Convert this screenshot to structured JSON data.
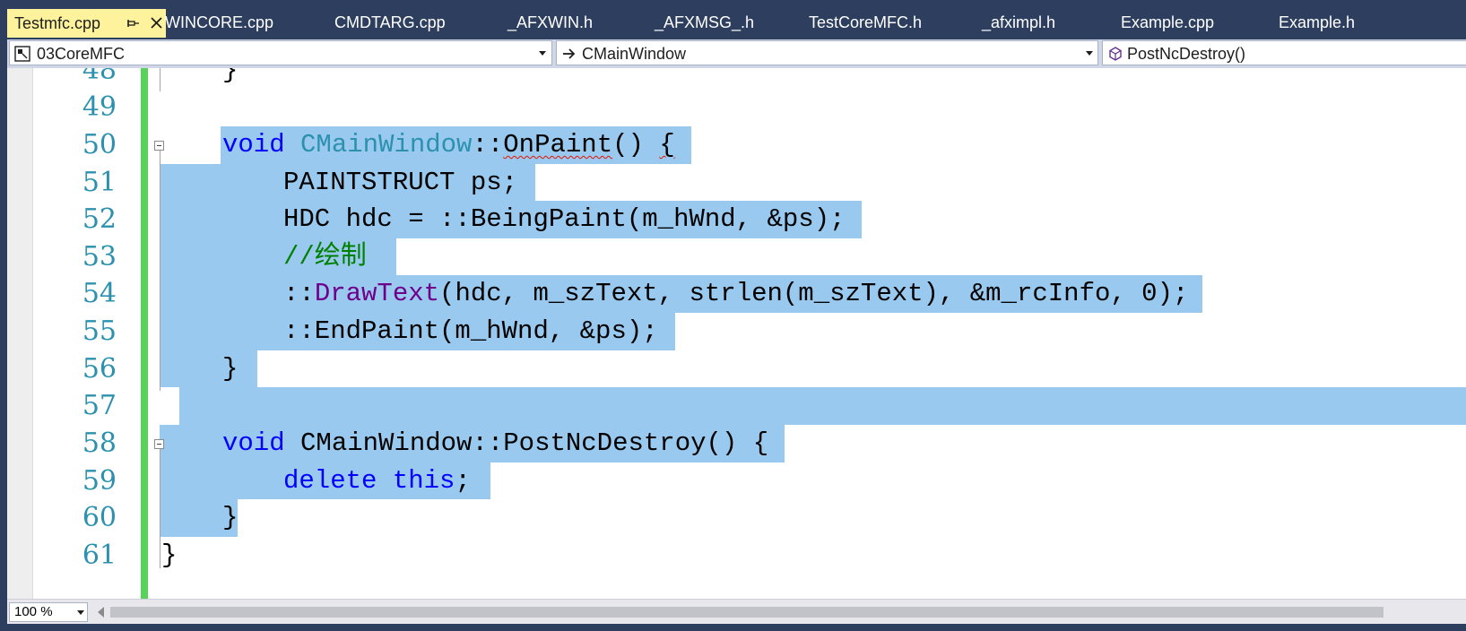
{
  "tabs": [
    {
      "label": "Testmfc.cpp",
      "active": true
    },
    {
      "label": "WINCORE.cpp"
    },
    {
      "label": "CMDTARG.cpp"
    },
    {
      "label": "_AFXWIN.h"
    },
    {
      "label": "_AFXMSG_.h"
    },
    {
      "label": "TestCoreMFC.h"
    },
    {
      "label": "_afximpl.h"
    },
    {
      "label": "Example.cpp"
    },
    {
      "label": "Example.h"
    }
  ],
  "navbar": {
    "project": "03CoreMFC",
    "scope": "CMainWindow",
    "member": "PostNcDestroy()"
  },
  "editor": {
    "line_numbers": [
      "48",
      "49",
      "50",
      "51",
      "52",
      "53",
      "54",
      "55",
      "56",
      "57",
      "58",
      "59",
      "60",
      "61"
    ],
    "lines": {
      "l48": "}",
      "l50": {
        "kw": "void",
        "cls": "CMainWindow",
        "sep": "::",
        "fn": "OnPaint",
        "paren": "()",
        "brace": "{"
      },
      "l51": "PAINTSTRUCT ps;",
      "l52": "HDC hdc = ::BeingPaint(m_hWnd, &ps);",
      "l53": "//绘制",
      "l54": {
        "pre": "::",
        "fn": "DrawText",
        "rest": "(hdc, m_szText, strlen(m_szText), &m_rcInfo, 0);"
      },
      "l55": "::EndPaint(m_hWnd, &ps);",
      "l56": "}",
      "l58": {
        "kw": "void",
        "rest": "CMainWindow::PostNcDestroy() {"
      },
      "l59": {
        "kw1": "delete",
        "kw2": "this",
        "end": ";"
      },
      "l60": "}",
      "l61": "}"
    },
    "colors": {
      "line_number": "#2b91af",
      "keyword": "#0000ff",
      "type": "#2b91af",
      "function": "#6f008a",
      "comment": "#008000",
      "selection": "#99c9ef",
      "changed_bar": "#57d35c"
    }
  },
  "bottom": {
    "zoom": "100 %"
  },
  "icons": {
    "pin": "pin-icon",
    "close": "close-icon",
    "project": "project-icon",
    "arrow": "arrow-right-icon",
    "member": "method-cube-icon"
  }
}
